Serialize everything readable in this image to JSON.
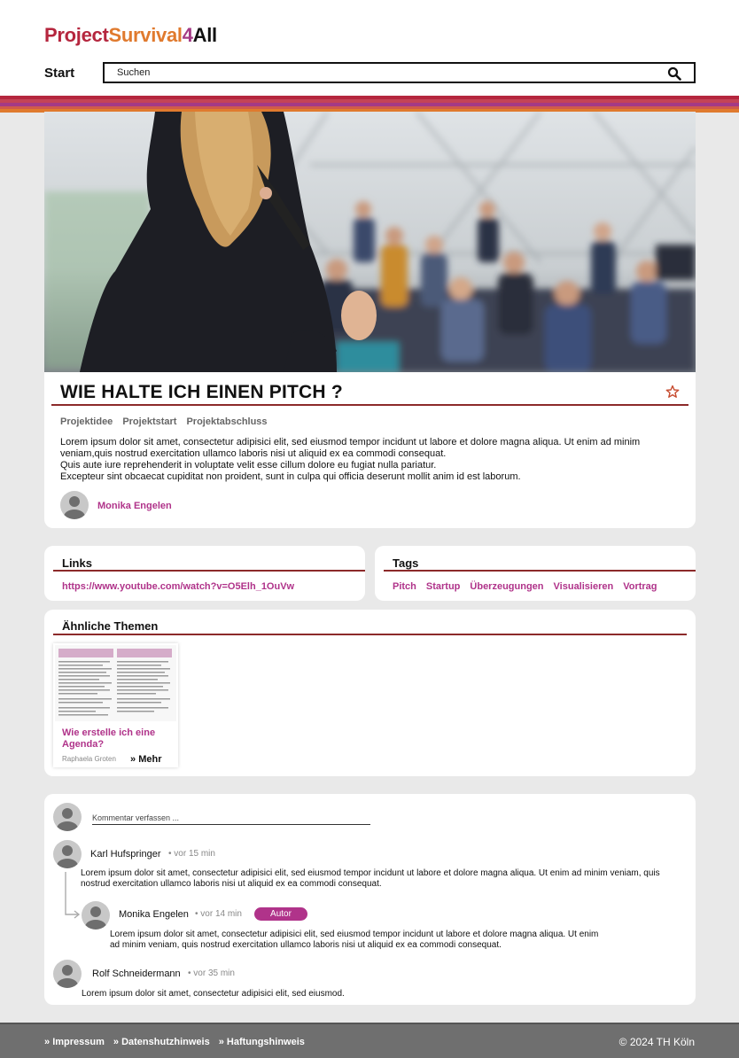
{
  "brand": {
    "part1": "Project",
    "part2": "Survival",
    "part3": "4",
    "part4": "All"
  },
  "nav": {
    "start": "Start"
  },
  "search": {
    "placeholder": "Suchen"
  },
  "colors": {
    "accent": "#b0338a",
    "rule": "#8c2a2a",
    "stripe_red": "#b5263e",
    "stripe_orange": "#e07a2e",
    "stripe_purple": "#a43a86"
  },
  "article": {
    "title": "WIE HALTE ICH EINEN PITCH ?",
    "categories": [
      "Projektidee",
      "Projektstart",
      "Projektabschluss"
    ],
    "body": [
      "Lorem ipsum dolor sit amet, consectetur adipisici elit, sed eiusmod  tempor incidunt ut labore et dolore magna aliqua. Ut enim ad minim veniam,quis nostrud exercitation ullamco laboris nisi ut aliquid ex ea  commodi consequat.",
      "Quis aute iure reprehenderit in voluptate velit esse  cillum dolore eu fugiat nulla pariatur.",
      "Excepteur sint obcaecat  cupiditat non proident, sunt in culpa qui officia deserunt mollit anim  id est laborum."
    ],
    "author": "Monika Engelen"
  },
  "links": {
    "heading": "Links",
    "url": "https://www.youtube.com/watch?v=O5Elh_1OuVw"
  },
  "tags": {
    "heading": "Tags",
    "items": [
      "Pitch",
      "Startup",
      "Überzeugungen",
      "Visualisieren",
      "Vortrag"
    ]
  },
  "related": {
    "heading": "Ähnliche Themen",
    "items": [
      {
        "title": "Wie erstelle ich eine Agenda?",
        "author": "Raphaela Groten",
        "more": "Mehr"
      }
    ]
  },
  "comments": {
    "placeholder": "Kommentar verfassen ...",
    "items": [
      {
        "name": "Karl Hufspringer",
        "time": "vor 15 min",
        "text": "Lorem ipsum dolor sit amet, consectetur adipisici elit, sed eiusmod  tempor incidunt ut labore et dolore magna aliqua. Ut enim ad minim  veniam, quis nostrud exercitation ullamco laboris nisi ut aliquid ex ea  commodi consequat."
      },
      {
        "name": "Monika Engelen",
        "time": "vor 14 min",
        "badge": "Autor",
        "text": "Lorem ipsum dolor sit amet, consectetur adipisici elit, sed eiusmod  tempor incidunt ut labore et dolore magna aliqua. Ut enim ad minim  veniam, quis nostrud exercitation ullamco laboris nisi ut aliquid ex ea  commodi consequat."
      },
      {
        "name": "Rolf Schneidermann",
        "time": "vor 35 min",
        "text": "Lorem ipsum dolor sit amet, consectetur adipisici elit, sed eiusmod."
      }
    ]
  },
  "footer": {
    "links": [
      "Impressum",
      "Datenshutzhinweis",
      "Haftungshinweis"
    ],
    "copyright": "© 2024 TH Köln"
  }
}
